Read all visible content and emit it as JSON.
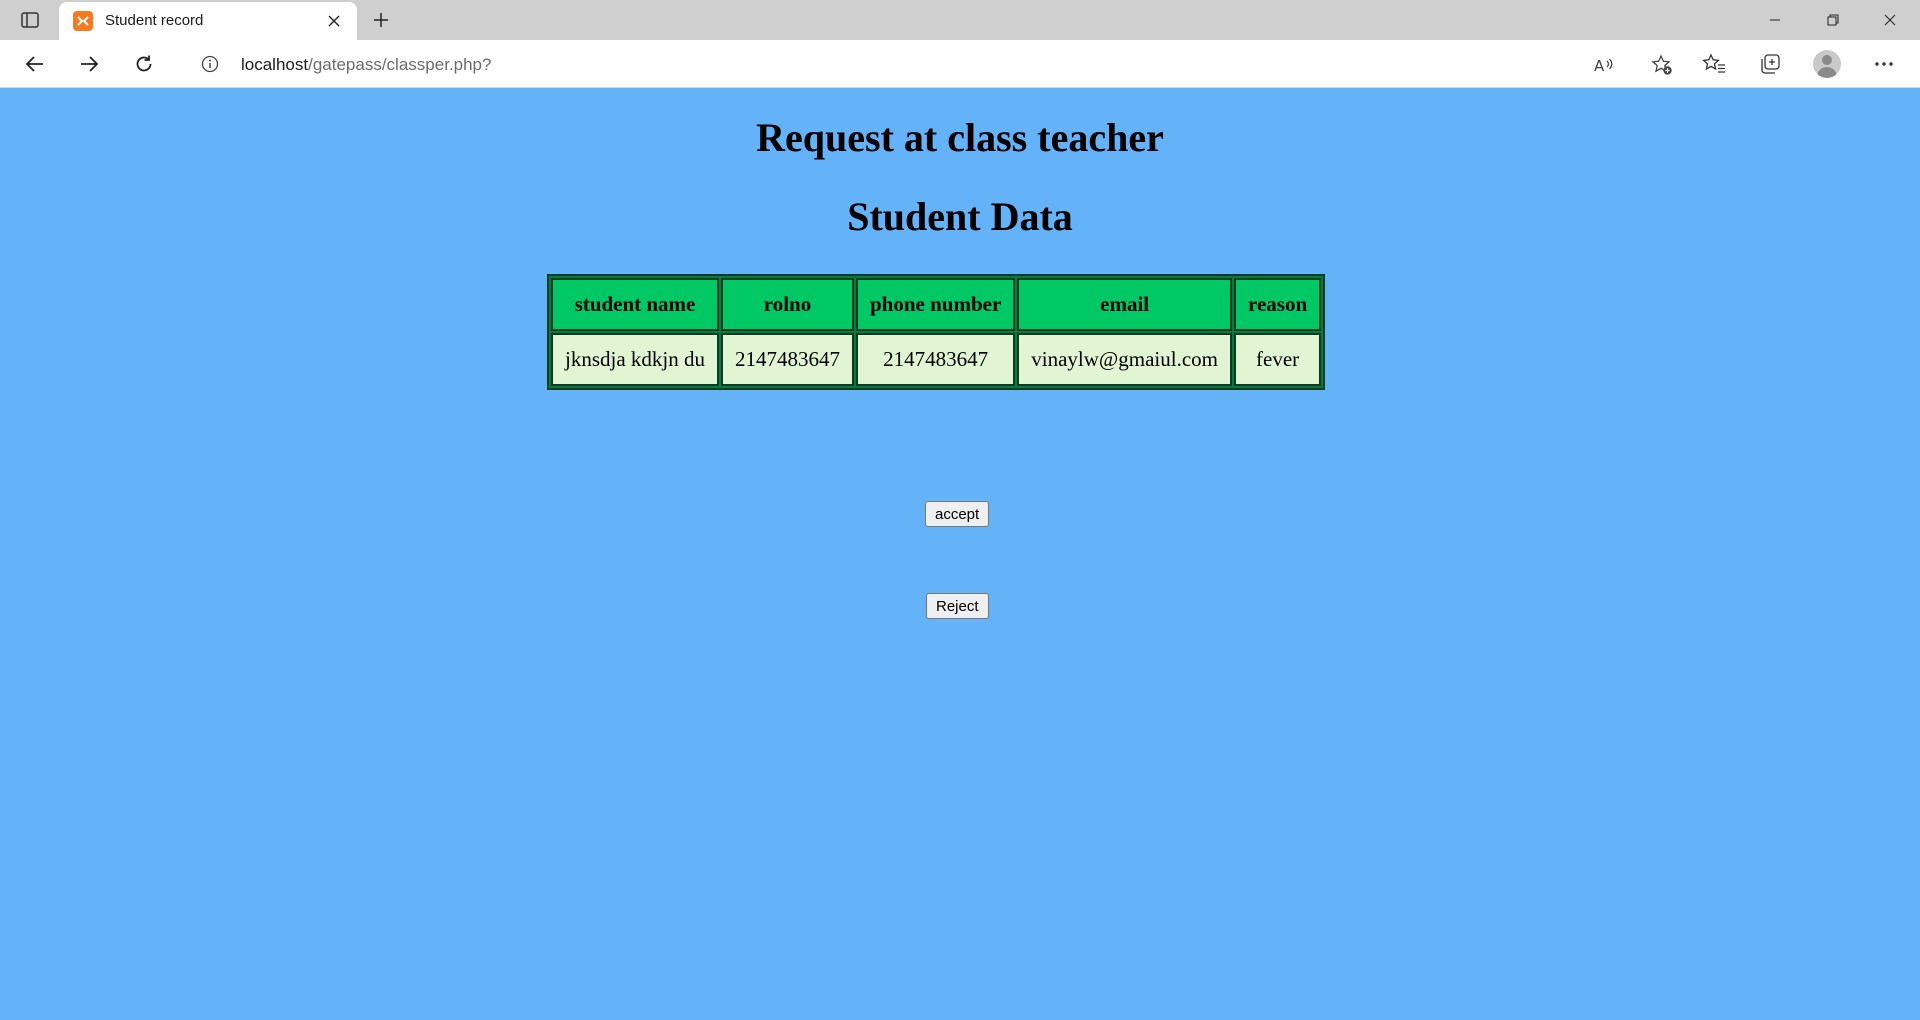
{
  "browser": {
    "tab": {
      "title": "Student record",
      "favicon": "xampp-icon"
    },
    "address": {
      "host": "localhost",
      "path": "/gatepass/classper.php?"
    },
    "icons": {
      "tab_actions": "tab-actions-icon",
      "close_tab": "close-icon",
      "new_tab": "plus-icon",
      "back": "back-arrow-icon",
      "forward": "forward-arrow-icon",
      "refresh": "refresh-icon",
      "site_info": "info-icon",
      "read_aloud": "read-aloud-icon",
      "add_favorite": "add-favorite-icon",
      "favorites": "favorites-icon",
      "collections": "collections-icon",
      "profile": "profile-icon",
      "menu": "more-icon"
    }
  },
  "page": {
    "title": "Request at class teacher",
    "subtitle": "Student Data",
    "background": "#64b2f8",
    "table": {
      "headers": [
        "student name",
        "rolno",
        "phone number",
        "email",
        "reason"
      ],
      "rows": [
        [
          "jknsdja kdkjn du",
          "2147483647",
          "2147483647",
          "vinaylw@gmaiul.com",
          "fever"
        ]
      ],
      "header_color": "#00c864",
      "cell_color": "#e1f5d4"
    },
    "buttons": {
      "accept": "accept",
      "reject": "Reject"
    }
  }
}
